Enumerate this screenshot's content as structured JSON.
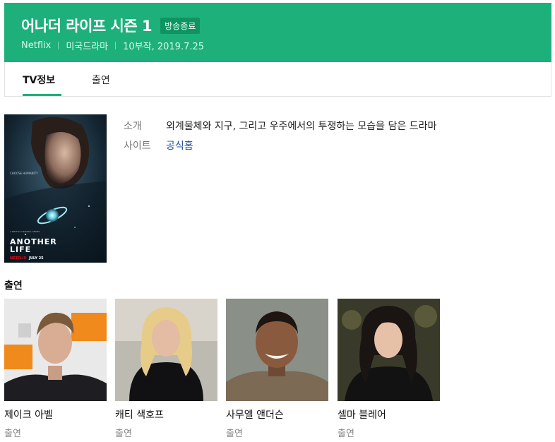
{
  "header": {
    "title": "어나더 라이프 시즌 1",
    "status_badge": "방송종료",
    "meta": [
      "Netflix",
      "미국드라마",
      "10부작, 2019.7.25"
    ],
    "accent_color": "#1db07a"
  },
  "tabs": [
    {
      "label": "TV정보",
      "active": true
    },
    {
      "label": "출연",
      "active": false
    }
  ],
  "poster": {
    "tagline": "CHOOSE HUMANITY",
    "studio": "A NETFLIX ORIGINAL SERIES",
    "title_line1": "ANOTHER",
    "title_line2": "LIFE",
    "brand": "NETFLIX",
    "date": "JULY 25"
  },
  "info": {
    "intro_label": "소개",
    "intro_value": "외계물체와 지구, 그리고 우주에서의 투쟁하는 모습을 담은 드라마",
    "site_label": "사이트",
    "site_value": "공식홈"
  },
  "cast_heading": "출연",
  "cast": [
    {
      "name": "제이크 아벨",
      "role": "출연"
    },
    {
      "name": "캐티 색호프",
      "role": "출연"
    },
    {
      "name": "사무엘 앤더슨",
      "role": "출연"
    },
    {
      "name": "셀마 블레어",
      "role": "출연"
    }
  ]
}
